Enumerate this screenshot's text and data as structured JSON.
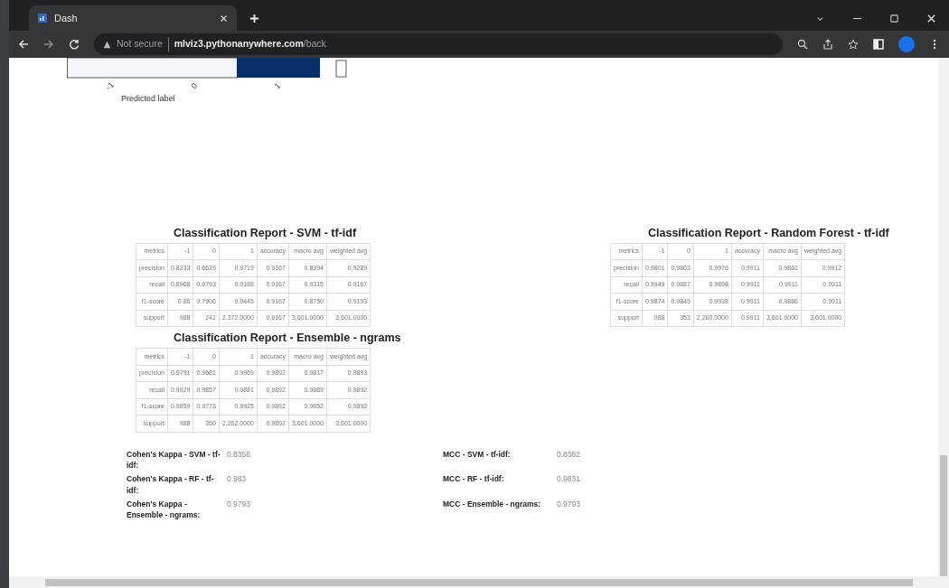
{
  "browser": {
    "tab_title": "Dash",
    "security": "Not secure",
    "url_host": "mlviz3.pythonanywhere.com",
    "url_path": "/back"
  },
  "confusion_matrix": {
    "tick_labels": [
      "-1",
      "0",
      "1"
    ],
    "xlabel": "Predicted label"
  },
  "reports": [
    {
      "title": "Classification Report - SVM - tf-idf",
      "columns": [
        "metrics",
        "-1",
        "0",
        "1",
        "accuracy",
        "macro avg",
        "weighted avg"
      ],
      "rows": [
        [
          "precision",
          "0.8233",
          "0.6629",
          "0.9719",
          "0.9167",
          "0.8394",
          "0.9289"
        ],
        [
          "recall",
          "0.8968",
          "0.9793",
          "0.9188",
          "0.9167",
          "0.9315",
          "0.9167"
        ],
        [
          "f1-score",
          "0.86",
          "0.7906",
          "0.9445",
          "0.9167",
          "0.8750",
          "0.9193"
        ],
        [
          "support",
          "988",
          "241",
          "2,372.0000",
          "0.9167",
          "3,601.0000",
          "3,601.0000"
        ]
      ]
    },
    {
      "title": "Classification Report - Random Forest - tf-idf",
      "columns": [
        "metrics",
        "-1",
        "0",
        "1",
        "accuracy",
        "macro avg",
        "weighted avg"
      ],
      "rows": [
        [
          "precision",
          "0.9801",
          "0.9803",
          "0.9976",
          "0.9911",
          "0.9861",
          "0.9912"
        ],
        [
          "recall",
          "0.9949",
          "0.9887",
          "0.9898",
          "0.9911",
          "0.9911",
          "0.9911"
        ],
        [
          "f1-score",
          "0.9874",
          "0.9845",
          "0.9938",
          "0.9911",
          "0.9886",
          "0.9911"
        ],
        [
          "support",
          "988",
          "353",
          "2,260.0000",
          "0.9911",
          "3,601.0000",
          "3,601.0000"
        ]
      ]
    },
    {
      "title": "Classification Report - Ensemble - ngrams",
      "columns": [
        "metrics",
        "-1",
        "0",
        "1",
        "accuracy",
        "macro avg",
        "weighted avg"
      ],
      "rows": [
        [
          "precision",
          "0.9791",
          "0.9681",
          "0.9969",
          "0.9892",
          "0.9817",
          "0.9893"
        ],
        [
          "recall",
          "0.9929",
          "0.9857",
          "0.9881",
          "0.9892",
          "0.9889",
          "0.9892"
        ],
        [
          "f1-score",
          "0.9859",
          "0.9773",
          "0.9925",
          "0.9892",
          "0.9852",
          "0.9892"
        ],
        [
          "support",
          "988",
          "350",
          "2,262.0000",
          "0.9892",
          "3,601.0000",
          "3,601.0000"
        ]
      ]
    }
  ],
  "scores": [
    {
      "kappa_label": "Cohen's Kappa - SVM - tf-idf:",
      "kappa_value": "0.8356",
      "mcc_label": "MCC - SVM - tf-idf:",
      "mcc_value": "0.8382"
    },
    {
      "kappa_label": "Cohen's Kappa - RF - tf-idf:",
      "kappa_value": "0.983",
      "mcc_label": "MCC - RF - tf-idf:",
      "mcc_value": "0.9831"
    },
    {
      "kappa_label": "Cohen's Kappa - Ensemble - ngrams:",
      "kappa_value": "0.9793",
      "mcc_label": "MCC - Ensemble - ngrams:",
      "mcc_value": "0.9793"
    }
  ]
}
